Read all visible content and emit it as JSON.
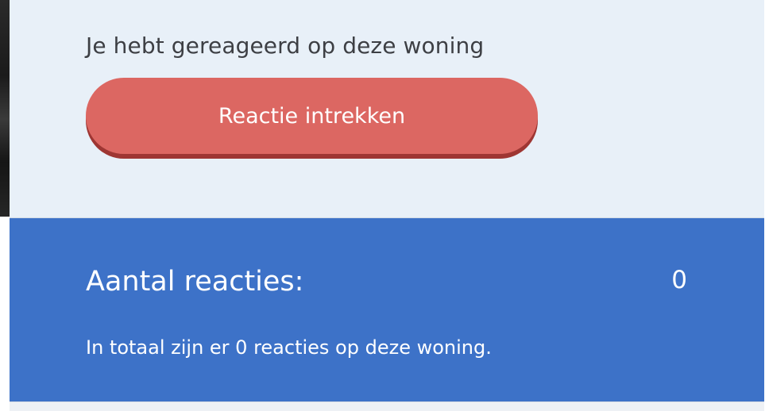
{
  "reaction": {
    "status_text": "Je hebt gereageerd op deze woning",
    "withdraw_label": "Reactie intrekken"
  },
  "reactions": {
    "title": "Aantal reacties:",
    "count": "0",
    "description": "In totaal zijn er 0 reacties op deze woning."
  },
  "colors": {
    "panel_background": "#e8f0f8",
    "withdraw_button": "#dc6762",
    "withdraw_button_shadow": "#9e3633",
    "reactions_background": "#3d72c8",
    "text_dark": "#3d3f44",
    "text_light": "#ffffff"
  }
}
